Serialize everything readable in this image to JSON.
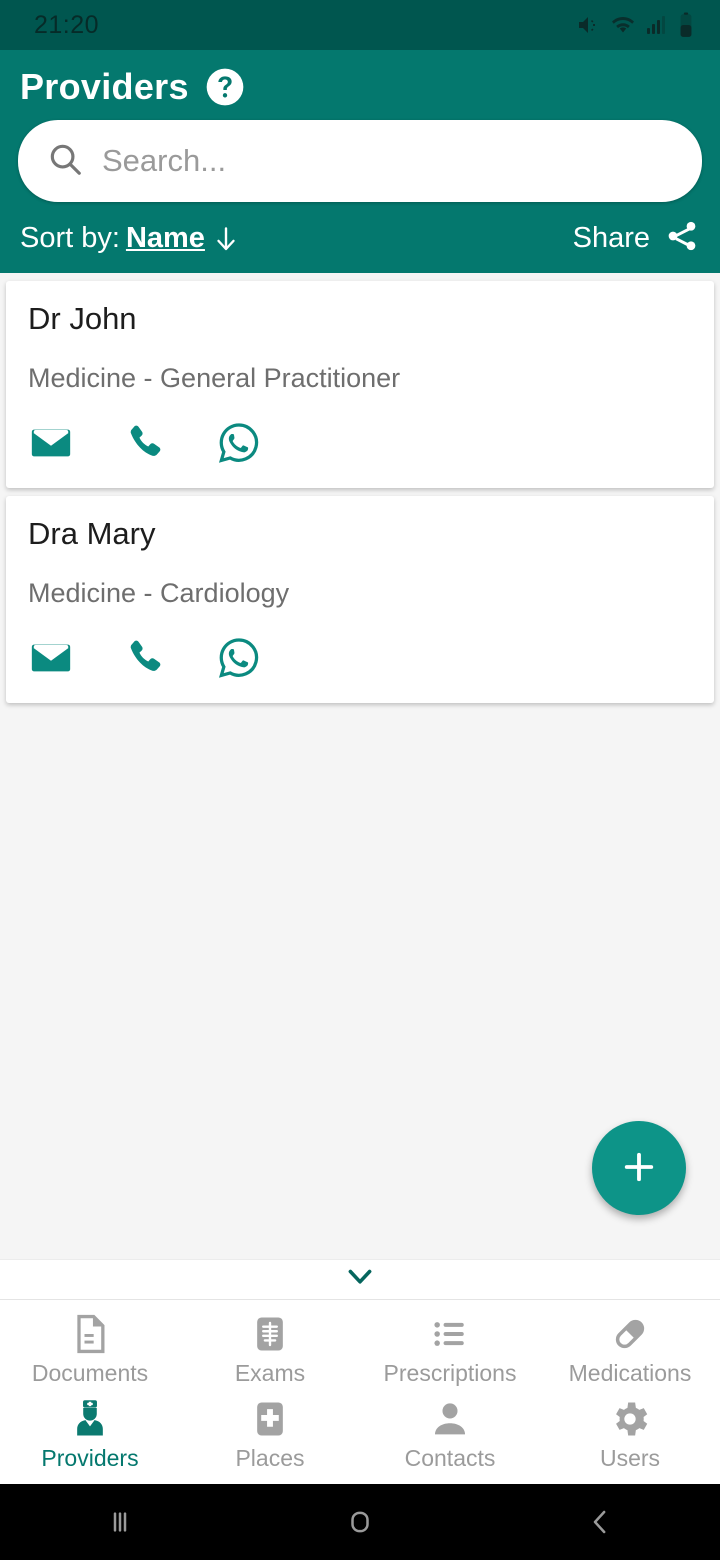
{
  "status_bar": {
    "time": "21:20",
    "icons": [
      "mute-vibrate-icon",
      "wifi-icon",
      "signal-icon",
      "battery-icon"
    ]
  },
  "app_bar": {
    "title": "Providers",
    "help_icon": "help-circle-icon",
    "search": {
      "placeholder": "Search...",
      "value": "",
      "icon": "search-icon"
    },
    "sort": {
      "label": "Sort by:",
      "value": "Name",
      "direction_icon": "arrow-down-icon"
    },
    "share": {
      "label": "Share",
      "icon": "share-icon"
    }
  },
  "colors": {
    "status_bar": "#00564f",
    "app_bar": "#04786e",
    "accent": "#0d9488",
    "background": "#f5f5f5",
    "card": "#ffffff",
    "nav_inactive": "#9b9b9b",
    "nav_active": "#04786e"
  },
  "providers": [
    {
      "name": "Dr John",
      "specialty": "Medicine - General Practitioner",
      "actions": [
        {
          "name": "email-icon"
        },
        {
          "name": "phone-icon"
        },
        {
          "name": "whatsapp-icon"
        }
      ]
    },
    {
      "name": "Dra Mary",
      "specialty": "Medicine - Cardiology",
      "actions": [
        {
          "name": "email-icon"
        },
        {
          "name": "phone-icon"
        },
        {
          "name": "whatsapp-icon"
        }
      ]
    }
  ],
  "fab": {
    "label": "+",
    "icon": "plus-icon"
  },
  "bottom_nav": {
    "collapse_icon": "chevron-down-icon",
    "row1": [
      {
        "label": "Documents",
        "icon": "document-icon",
        "active": false
      },
      {
        "label": "Exams",
        "icon": "exam-icon",
        "active": false
      },
      {
        "label": "Prescriptions",
        "icon": "prescription-list-icon",
        "active": false
      },
      {
        "label": "Medications",
        "icon": "pill-icon",
        "active": false
      }
    ],
    "row2": [
      {
        "label": "Providers",
        "icon": "doctor-icon",
        "active": true
      },
      {
        "label": "Places",
        "icon": "hospital-icon",
        "active": false
      },
      {
        "label": "Contacts",
        "icon": "person-icon",
        "active": false
      },
      {
        "label": "Users",
        "icon": "gear-icon",
        "active": false
      }
    ]
  },
  "android_nav": {
    "recents": "recents-icon",
    "home": "home-icon",
    "back": "back-icon"
  }
}
